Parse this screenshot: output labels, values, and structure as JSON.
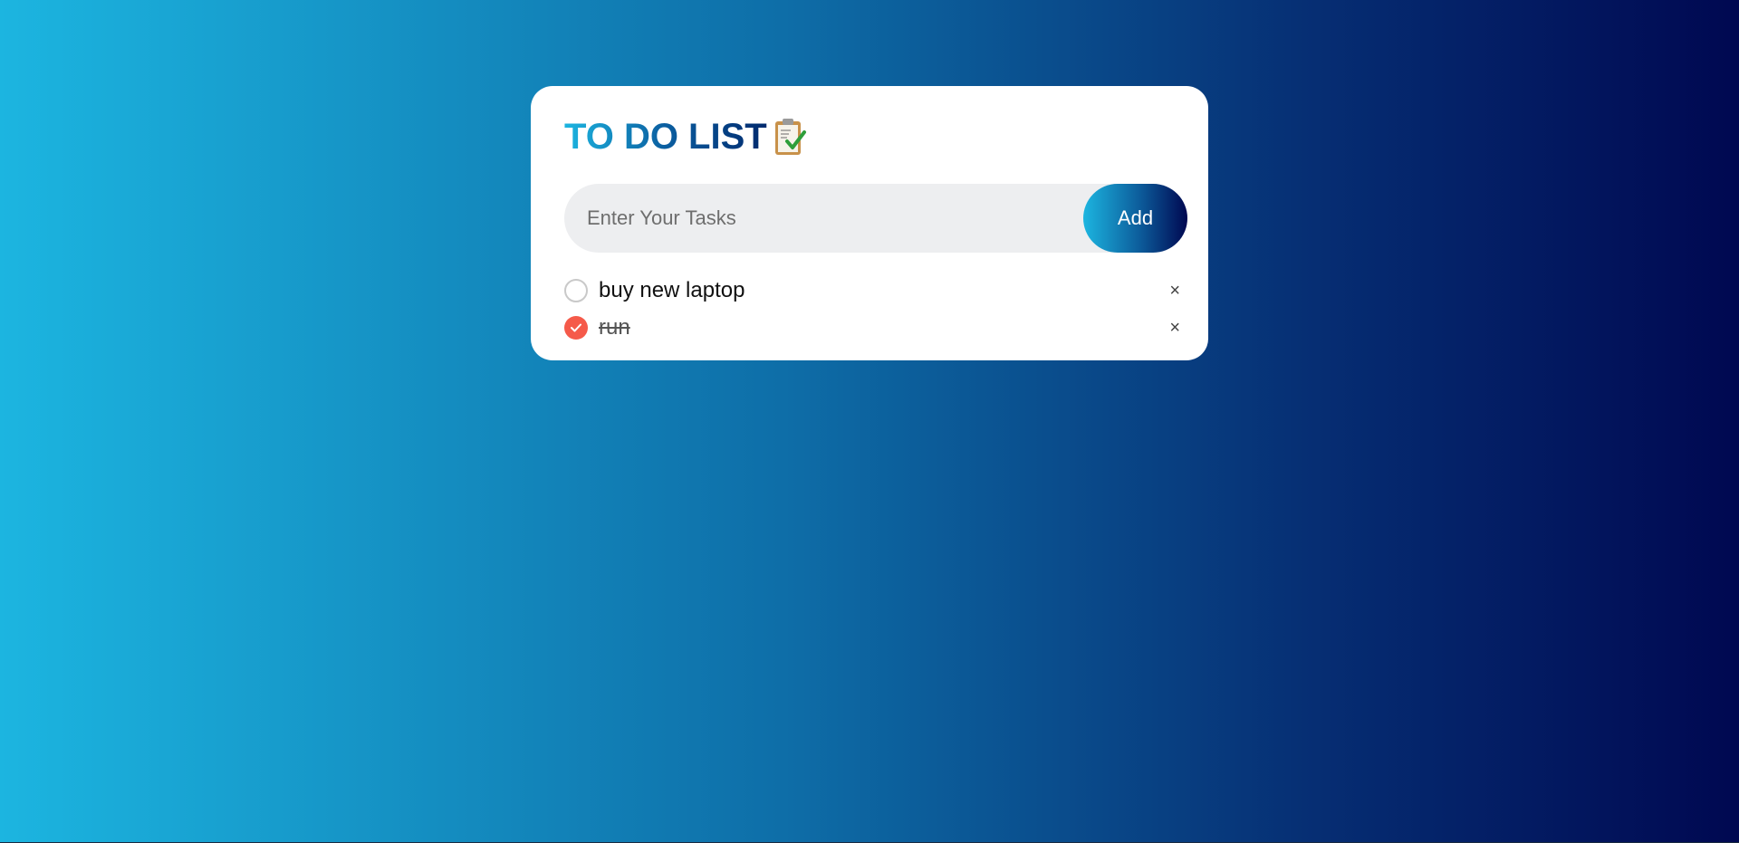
{
  "app": {
    "title": "TO DO LIST",
    "title_icon": "clipboard-check-icon"
  },
  "input": {
    "placeholder": "Enter Your Tasks",
    "value": ""
  },
  "add_button": {
    "label": "Add"
  },
  "tasks": [
    {
      "text": "buy new laptop",
      "done": false,
      "delete_symbol": "×"
    },
    {
      "text": "run",
      "done": true,
      "delete_symbol": "×"
    }
  ],
  "colors": {
    "gradient_start": "#1cb5e0",
    "gradient_end": "#000851",
    "checked_circle": "#f55a4a",
    "input_background": "#edeef0",
    "card_background": "#ffffff"
  }
}
